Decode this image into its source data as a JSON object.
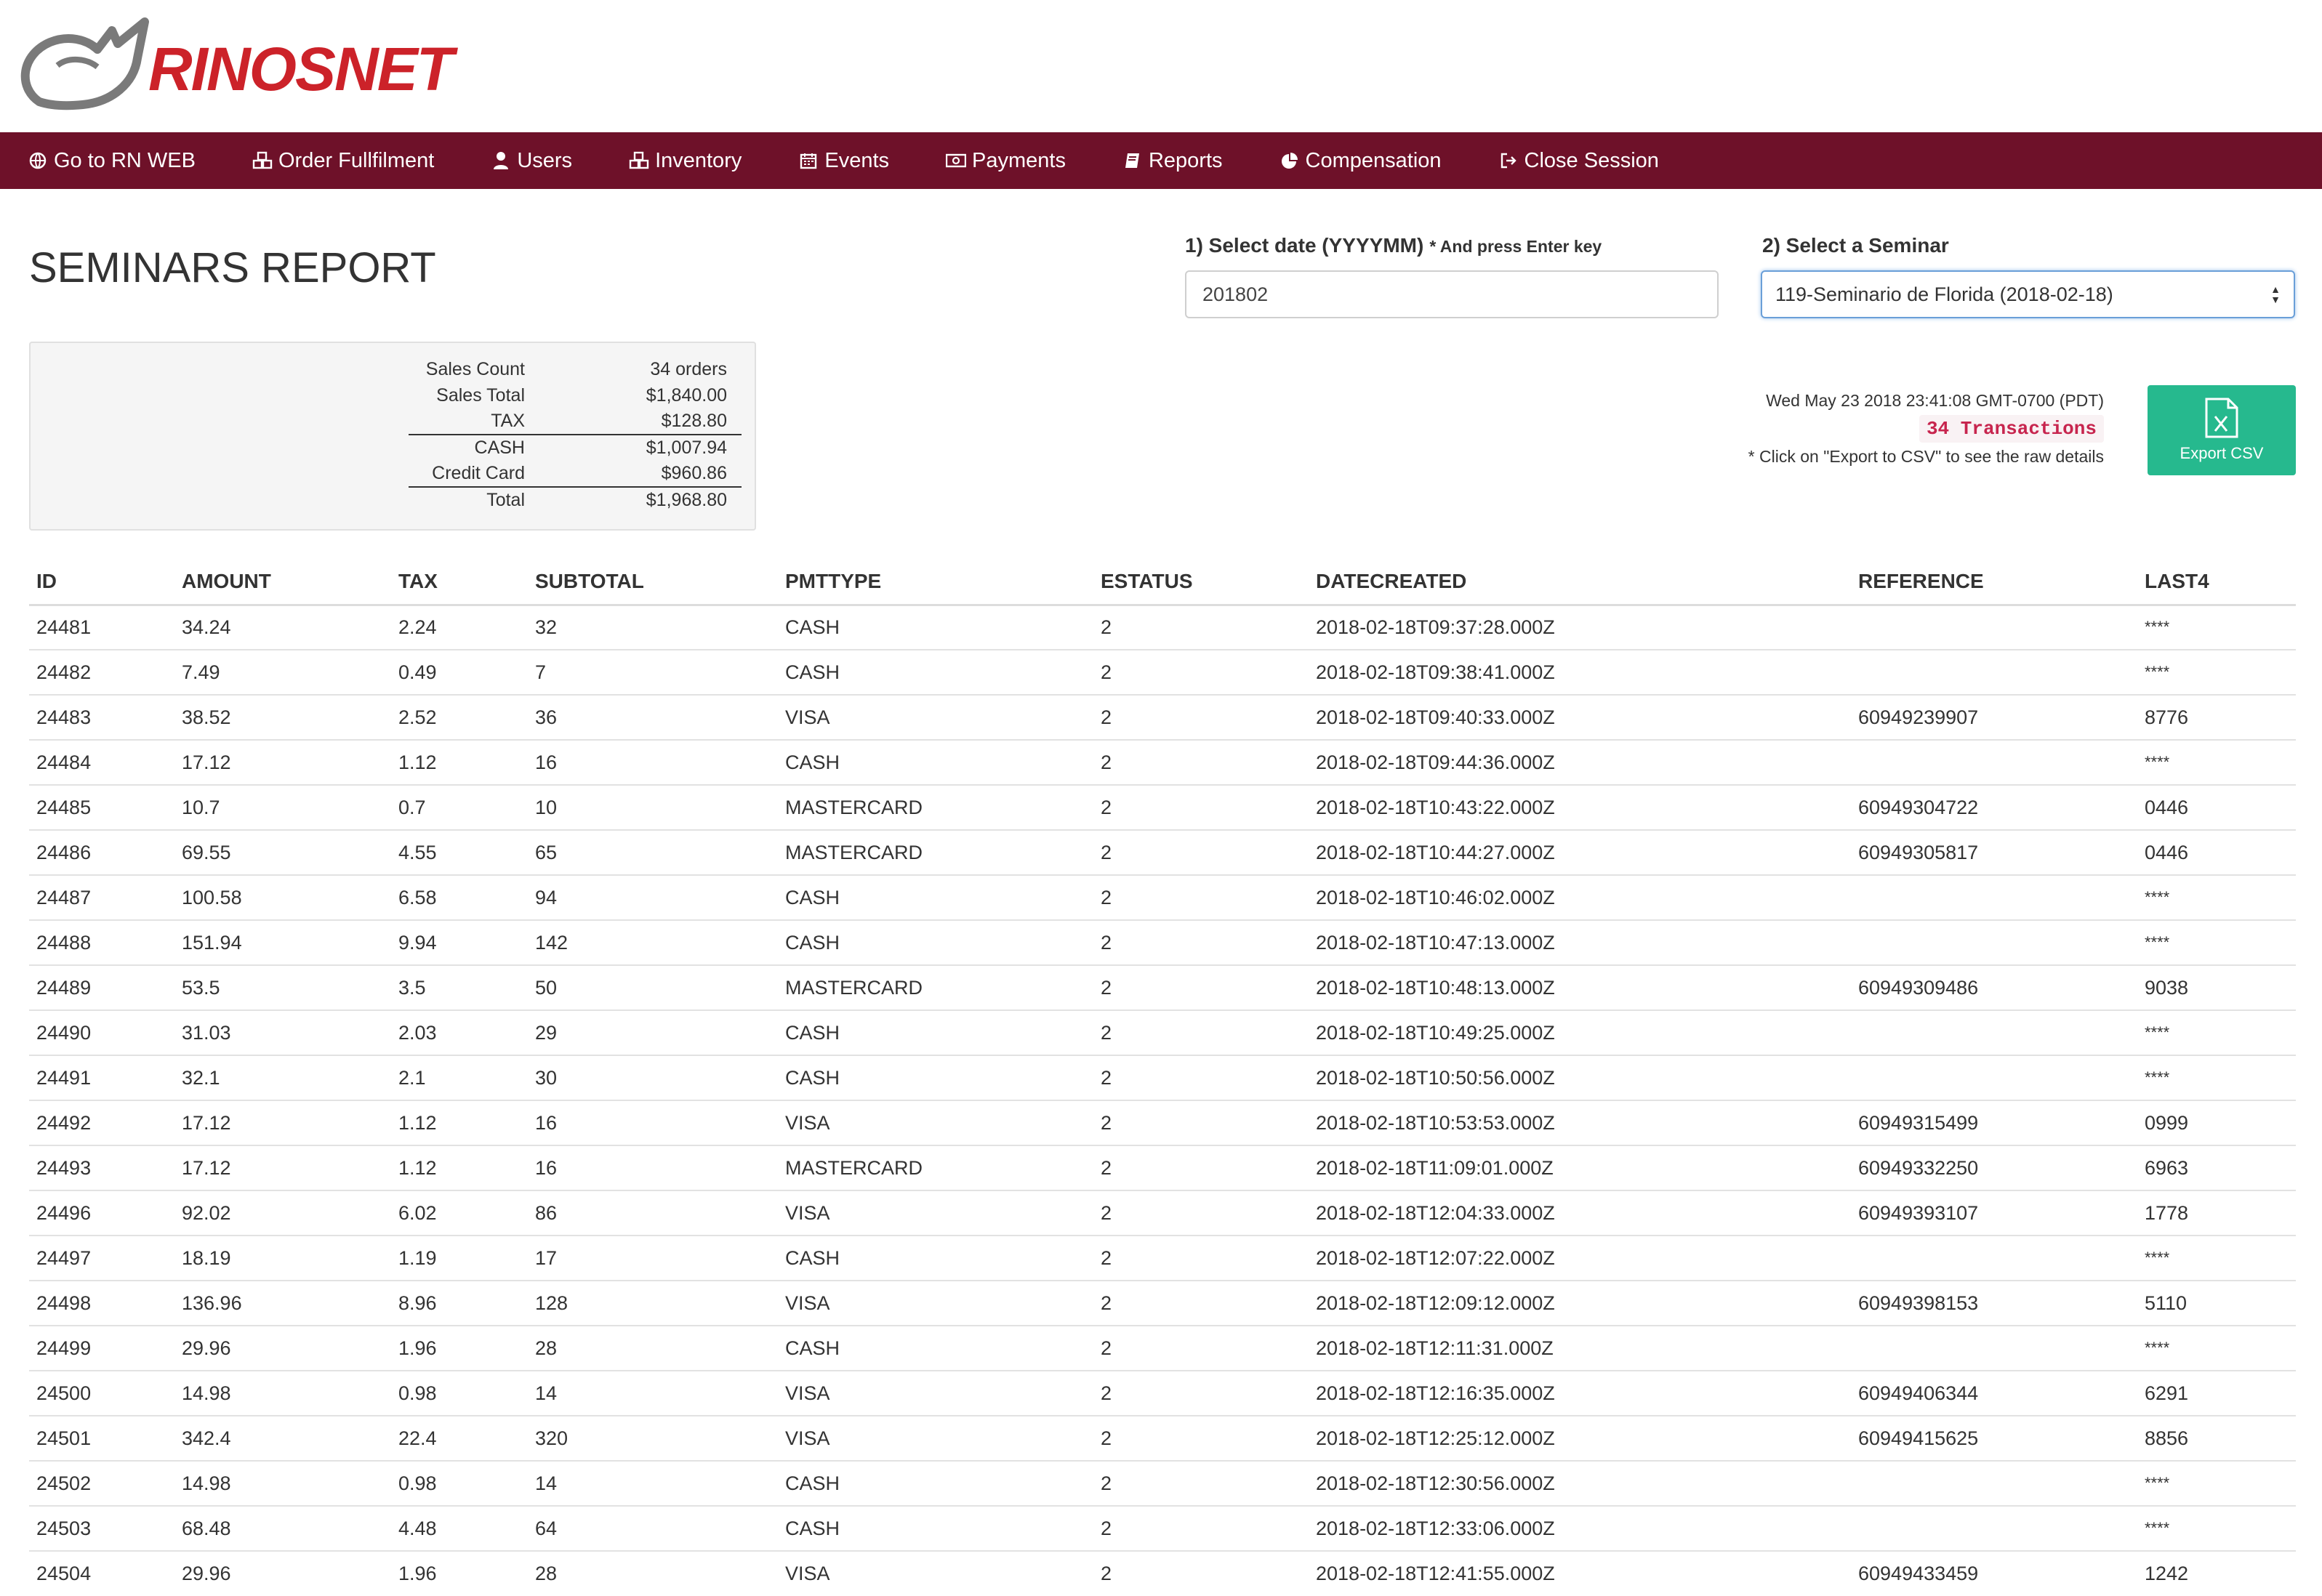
{
  "brand": {
    "name": "RINOSNET"
  },
  "nav": [
    {
      "label": "Go to RN WEB",
      "icon": "globe-icon"
    },
    {
      "label": "Order Fullfilment",
      "icon": "cubes-icon"
    },
    {
      "label": "Users",
      "icon": "user-icon"
    },
    {
      "label": "Inventory",
      "icon": "cubes-icon"
    },
    {
      "label": "Events",
      "icon": "calendar-icon"
    },
    {
      "label": "Payments",
      "icon": "money-icon"
    },
    {
      "label": "Reports",
      "icon": "book-icon"
    },
    {
      "label": "Compensation",
      "icon": "pie-chart-icon"
    },
    {
      "label": "Close Session",
      "icon": "sign-out-icon"
    }
  ],
  "page": {
    "title": "SEMINARS REPORT"
  },
  "controls": {
    "date_label": "1) Select date (YYYYMM)",
    "date_hint": "* And press Enter key",
    "date_value": "201802",
    "seminar_label": "2) Select a Seminar",
    "seminar_value": "119-Seminario de Florida (2018-02-18)"
  },
  "summary": {
    "sales_count_label": "Sales Count",
    "sales_count": "34 orders",
    "sales_total_label": "Sales Total",
    "sales_total": "$1,840.00",
    "tax_label": "TAX",
    "tax": "$128.80",
    "cash_label": "CASH",
    "cash": "$1,007.94",
    "credit_label": "Credit Card",
    "credit": "$960.86",
    "total_label": "Total",
    "total": "$1,968.80"
  },
  "info": {
    "timestamp": "Wed May 23 2018 23:41:08 GMT-0700 (PDT)",
    "transactions": "34 Transactions",
    "note": "* Click on \"Export to CSV\" to see the raw details"
  },
  "export": {
    "label": "Export CSV",
    "icon": "excel-file-icon"
  },
  "table": {
    "columns": [
      "ID",
      "AMOUNT",
      "TAX",
      "SUBTOTAL",
      "PMTTYPE",
      "ESTATUS",
      "DATECREATED",
      "REFERENCE",
      "LAST4"
    ],
    "rows": [
      [
        "24481",
        "34.24",
        "2.24",
        "32",
        "CASH",
        "2",
        "2018-02-18T09:37:28.000Z",
        "",
        "****"
      ],
      [
        "24482",
        "7.49",
        "0.49",
        "7",
        "CASH",
        "2",
        "2018-02-18T09:38:41.000Z",
        "",
        "****"
      ],
      [
        "24483",
        "38.52",
        "2.52",
        "36",
        "VISA",
        "2",
        "2018-02-18T09:40:33.000Z",
        "60949239907",
        "8776"
      ],
      [
        "24484",
        "17.12",
        "1.12",
        "16",
        "CASH",
        "2",
        "2018-02-18T09:44:36.000Z",
        "",
        "****"
      ],
      [
        "24485",
        "10.7",
        "0.7",
        "10",
        "MASTERCARD",
        "2",
        "2018-02-18T10:43:22.000Z",
        "60949304722",
        "0446"
      ],
      [
        "24486",
        "69.55",
        "4.55",
        "65",
        "MASTERCARD",
        "2",
        "2018-02-18T10:44:27.000Z",
        "60949305817",
        "0446"
      ],
      [
        "24487",
        "100.58",
        "6.58",
        "94",
        "CASH",
        "2",
        "2018-02-18T10:46:02.000Z",
        "",
        "****"
      ],
      [
        "24488",
        "151.94",
        "9.94",
        "142",
        "CASH",
        "2",
        "2018-02-18T10:47:13.000Z",
        "",
        "****"
      ],
      [
        "24489",
        "53.5",
        "3.5",
        "50",
        "MASTERCARD",
        "2",
        "2018-02-18T10:48:13.000Z",
        "60949309486",
        "9038"
      ],
      [
        "24490",
        "31.03",
        "2.03",
        "29",
        "CASH",
        "2",
        "2018-02-18T10:49:25.000Z",
        "",
        "****"
      ],
      [
        "24491",
        "32.1",
        "2.1",
        "30",
        "CASH",
        "2",
        "2018-02-18T10:50:56.000Z",
        "",
        "****"
      ],
      [
        "24492",
        "17.12",
        "1.12",
        "16",
        "VISA",
        "2",
        "2018-02-18T10:53:53.000Z",
        "60949315499",
        "0999"
      ],
      [
        "24493",
        "17.12",
        "1.12",
        "16",
        "MASTERCARD",
        "2",
        "2018-02-18T11:09:01.000Z",
        "60949332250",
        "6963"
      ],
      [
        "24496",
        "92.02",
        "6.02",
        "86",
        "VISA",
        "2",
        "2018-02-18T12:04:33.000Z",
        "60949393107",
        "1778"
      ],
      [
        "24497",
        "18.19",
        "1.19",
        "17",
        "CASH",
        "2",
        "2018-02-18T12:07:22.000Z",
        "",
        "****"
      ],
      [
        "24498",
        "136.96",
        "8.96",
        "128",
        "VISA",
        "2",
        "2018-02-18T12:09:12.000Z",
        "60949398153",
        "5110"
      ],
      [
        "24499",
        "29.96",
        "1.96",
        "28",
        "CASH",
        "2",
        "2018-02-18T12:11:31.000Z",
        "",
        "****"
      ],
      [
        "24500",
        "14.98",
        "0.98",
        "14",
        "VISA",
        "2",
        "2018-02-18T12:16:35.000Z",
        "60949406344",
        "6291"
      ],
      [
        "24501",
        "342.4",
        "22.4",
        "320",
        "VISA",
        "2",
        "2018-02-18T12:25:12.000Z",
        "60949415625",
        "8856"
      ],
      [
        "24502",
        "14.98",
        "0.98",
        "14",
        "CASH",
        "2",
        "2018-02-18T12:30:56.000Z",
        "",
        "****"
      ],
      [
        "24503",
        "68.48",
        "4.48",
        "64",
        "CASH",
        "2",
        "2018-02-18T12:33:06.000Z",
        "",
        "****"
      ],
      [
        "24504",
        "29.96",
        "1.96",
        "28",
        "VISA",
        "2",
        "2018-02-18T12:41:55.000Z",
        "60949433459",
        "1242"
      ]
    ]
  },
  "colors": {
    "nav_bg": "#6e1129",
    "brand_red": "#cc2229",
    "export_green": "#26b98e",
    "badge_red": "#c7254e"
  }
}
